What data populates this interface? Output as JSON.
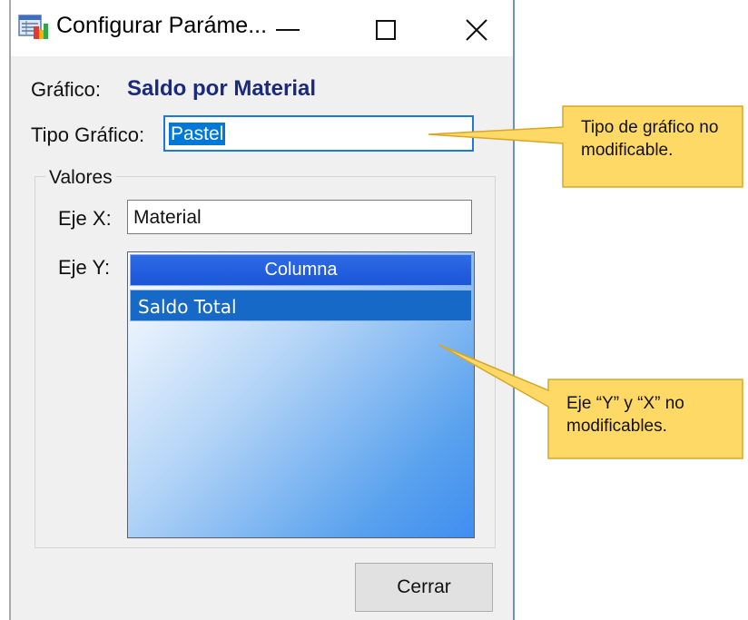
{
  "window": {
    "title": "Configurar Paráme..."
  },
  "form": {
    "grafico_label": "Gráfico:",
    "grafico_value": "Saldo por Material",
    "tipo_label": "Tipo Gráfico:",
    "tipo_value": "Pastel",
    "valores_label": "Valores",
    "ejex_label": "Eje X:",
    "ejex_value": "Material",
    "ejey_label": "Eje Y:",
    "grid": {
      "header": "Columna",
      "rows": [
        "Saldo Total"
      ]
    },
    "cerrar_label": "Cerrar"
  },
  "callouts": [
    {
      "lines": [
        "Tipo de gráfico no",
        "modificable."
      ]
    },
    {
      "lines": [
        "Eje “Y” y “X” no",
        "modificables."
      ]
    }
  ],
  "colors": {
    "callout_fill": "#ffd966",
    "callout_border": "#d6a728",
    "selection": "#0078d7",
    "grafico_value": "#1b2a7a"
  }
}
